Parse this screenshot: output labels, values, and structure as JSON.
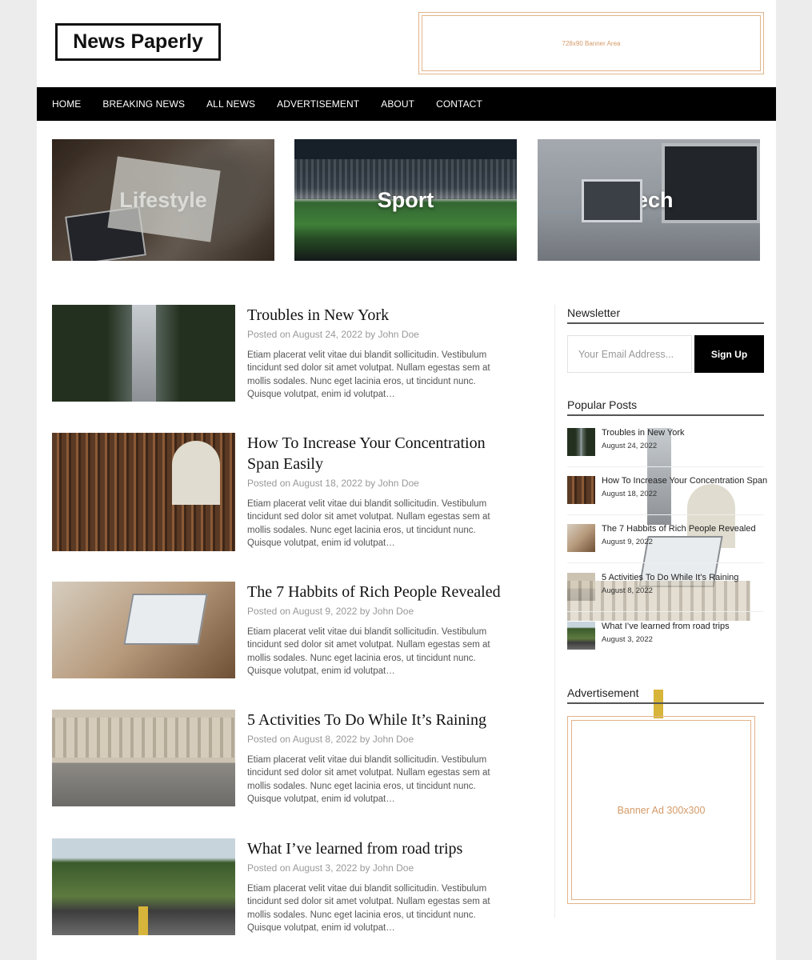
{
  "site": {
    "logo": "News Paperly",
    "top_banner": "728x90 Banner Area"
  },
  "nav": {
    "items": [
      "HOME",
      "BREAKING NEWS",
      "ALL NEWS",
      "ADVERTISEMENT",
      "ABOUT",
      "CONTACT"
    ]
  },
  "categories": [
    {
      "label": "Lifestyle"
    },
    {
      "label": "Sport"
    },
    {
      "label": "Tech"
    }
  ],
  "posts": [
    {
      "title": "Troubles in New York",
      "meta": "Posted on August 24, 2022 by John Doe",
      "excerpt": "Etiam placerat velit vitae dui blandit sollicitudin. Vestibulum tincidunt sed dolor sit amet volutpat. Nullam egestas sem at mollis sodales. Nunc eget lacinia eros, ut tincidunt nunc. Quisque volutpat, enim id volutpat…"
    },
    {
      "title": "How To Increase Your Concentration Span Easily",
      "meta": "Posted on August 18, 2022 by John Doe",
      "excerpt": "Etiam placerat velit vitae dui blandit sollicitudin. Vestibulum tincidunt sed dolor sit amet volutpat. Nullam egestas sem at mollis sodales. Nunc eget lacinia eros, ut tincidunt nunc. Quisque volutpat, enim id volutpat…"
    },
    {
      "title": "The 7 Habbits of Rich People Revealed",
      "meta": "Posted on August 9, 2022 by John Doe",
      "excerpt": "Etiam placerat velit vitae dui blandit sollicitudin. Vestibulum tincidunt sed dolor sit amet volutpat. Nullam egestas sem at mollis sodales. Nunc eget lacinia eros, ut tincidunt nunc. Quisque volutpat, enim id volutpat…"
    },
    {
      "title": "5 Activities To Do While It’s Raining",
      "meta": "Posted on August 8, 2022 by John Doe",
      "excerpt": "Etiam placerat velit vitae dui blandit sollicitudin. Vestibulum tincidunt sed dolor sit amet volutpat. Nullam egestas sem at mollis sodales. Nunc eget lacinia eros, ut tincidunt nunc. Quisque volutpat, enim id volutpat…"
    },
    {
      "title": "What I’ve learned from road trips",
      "meta": "Posted on August 3, 2022 by John Doe",
      "excerpt": "Etiam placerat velit vitae dui blandit sollicitudin. Vestibulum tincidunt sed dolor sit amet volutpat. Nullam egestas sem at mollis sodales. Nunc eget lacinia eros, ut tincidunt nunc. Quisque volutpat, enim id volutpat…"
    }
  ],
  "sidebar": {
    "newsletter": {
      "title": "Newsletter",
      "placeholder": "Your Email Address...",
      "button": "Sign Up"
    },
    "popular": {
      "title": "Popular Posts",
      "items": [
        {
          "title": "Troubles in New York",
          "date": "August 24, 2022"
        },
        {
          "title": "How To Increase Your Concentration Span",
          "date": "August 18, 2022"
        },
        {
          "title": "The 7 Habbits of Rich People Revealed",
          "date": "August 9, 2022"
        },
        {
          "title": "5 Activities To Do While It’s Raining",
          "date": "August 8, 2022"
        },
        {
          "title": "What I’ve learned from road trips",
          "date": "August 3, 2022"
        }
      ]
    },
    "advertisement": {
      "title": "Advertisement",
      "banner": "Banner Ad 300x300"
    }
  }
}
